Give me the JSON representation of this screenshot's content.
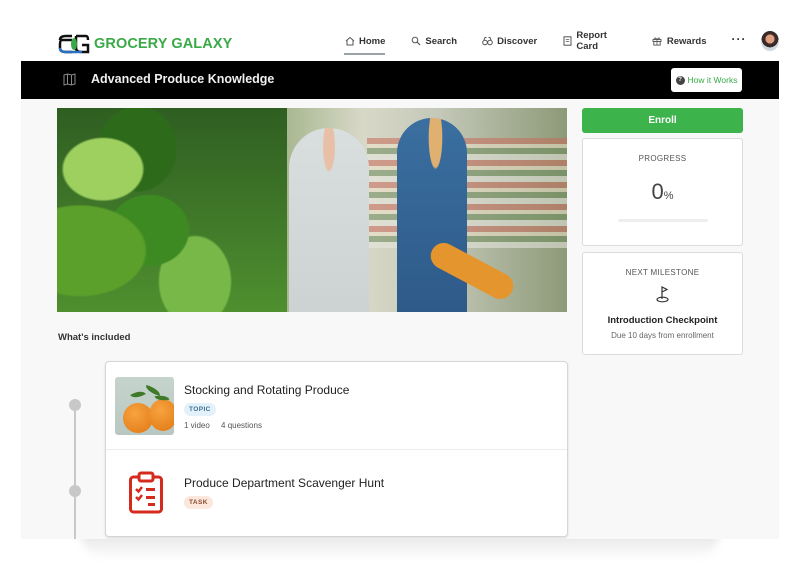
{
  "brand": {
    "name": "GROCERY GALAXY",
    "logo_icon": "grocery-galaxy-logo",
    "accent_color": "#3aaa48"
  },
  "nav": {
    "items": [
      {
        "label": "Home",
        "icon": "home-icon",
        "active": true
      },
      {
        "label": "Search",
        "icon": "search-icon",
        "active": false
      },
      {
        "label": "Discover",
        "icon": "binoculars-icon",
        "active": false
      },
      {
        "label": "Report Card",
        "icon": "report-icon",
        "active": false
      },
      {
        "label": "Rewards",
        "icon": "gift-icon",
        "active": false
      }
    ],
    "more_label": "···",
    "avatar_icon": "user-avatar"
  },
  "banner": {
    "icon": "book-map-icon",
    "title": "Advanced Produce Knowledge",
    "how_it_works_label": "How it Works",
    "how_it_works_icon": "question-icon"
  },
  "hero": {
    "description": "produce-department-photo"
  },
  "sidebar": {
    "enroll_label": "Enroll",
    "progress": {
      "label": "PROGRESS",
      "value": "0",
      "unit": "%",
      "fraction": 0
    },
    "milestone": {
      "label": "NEXT MILESTONE",
      "icon": "flag-icon",
      "title": "Introduction Checkpoint",
      "subtitle": "Due 10 days from enrollment"
    }
  },
  "included": {
    "heading": "What's included",
    "items": [
      {
        "title": "Stocking and Rotating Produce",
        "badge": "TOPIC",
        "meta": [
          "1 video",
          "4 questions"
        ],
        "thumb": "oranges-thumbnail"
      },
      {
        "title": "Produce Department Scavenger Hunt",
        "badge": "TASK",
        "icon": "clipboard-checklist-icon",
        "icon_color": "#d42b1e"
      }
    ]
  }
}
